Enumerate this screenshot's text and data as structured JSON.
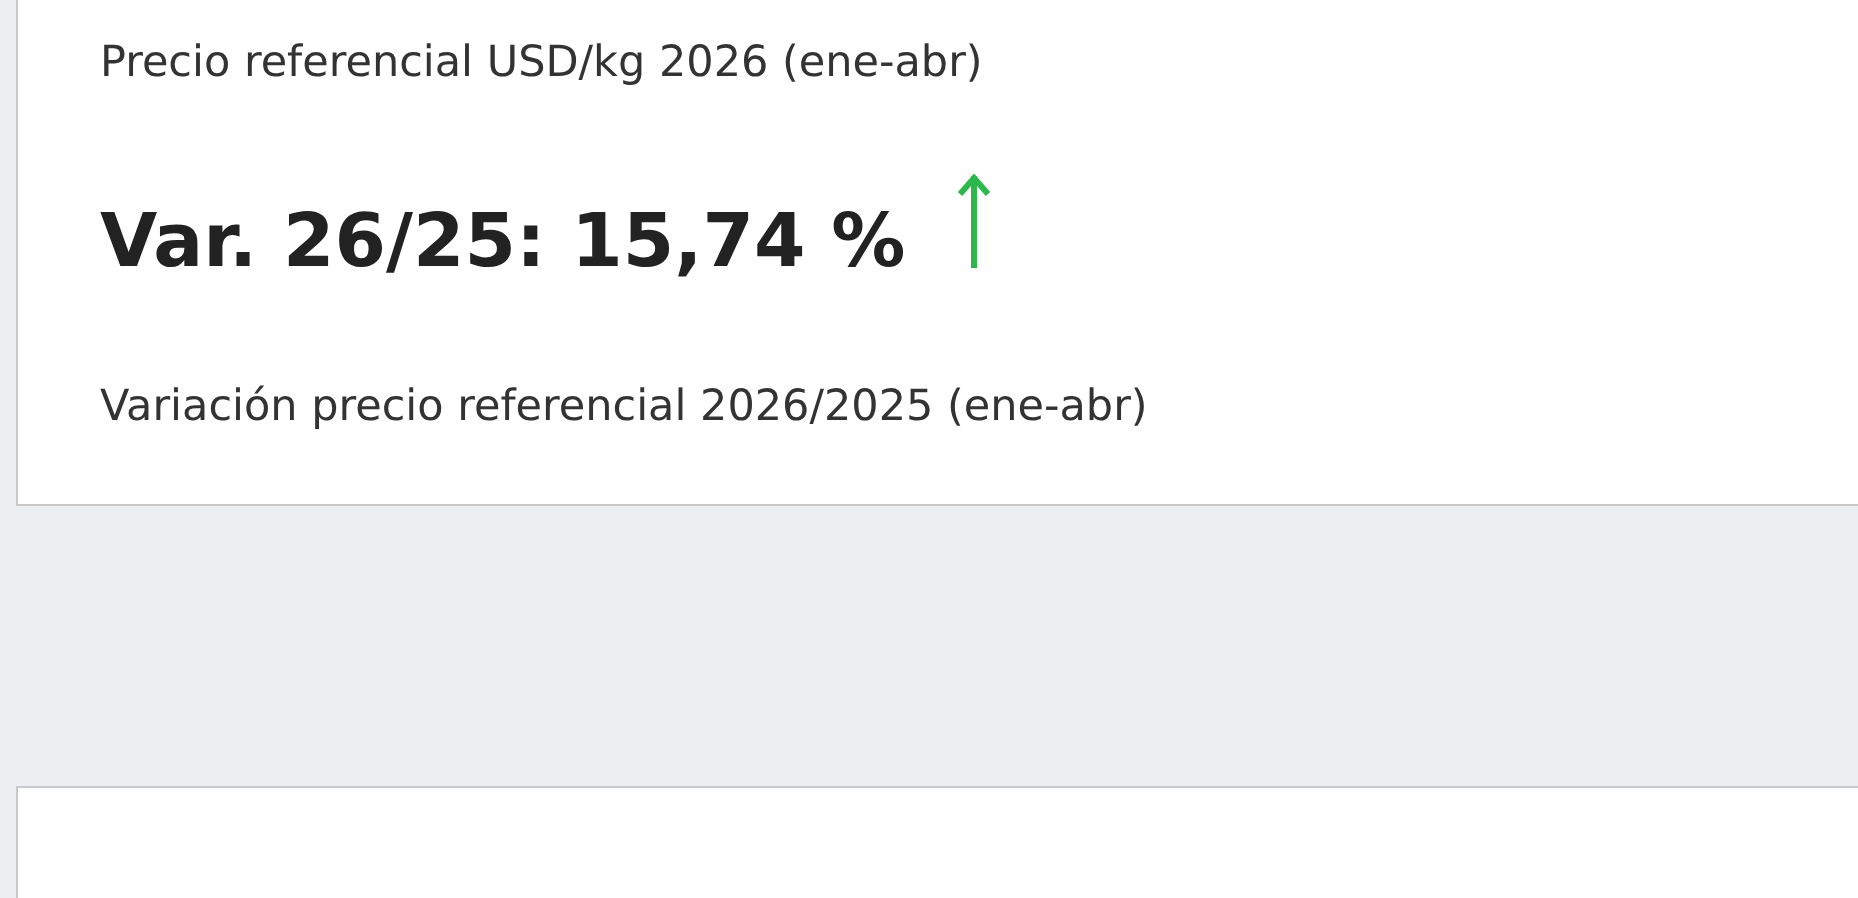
{
  "card": {
    "caption": "Precio referencial USD/kg 2026 (ene-abr)",
    "variation": {
      "label": "Var. 26/25: 15,74 %",
      "rising": true
    },
    "description": "Variación precio referencial 2026/2025 (ene-abr)"
  }
}
